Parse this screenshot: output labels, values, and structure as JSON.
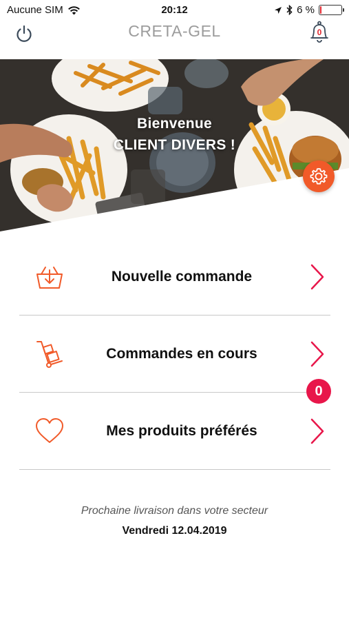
{
  "status_bar": {
    "carrier": "Aucune SIM",
    "time": "20:12",
    "battery_text": "6 %",
    "battery_level": 0.06,
    "icons": [
      "wifi-icon",
      "location-arrow-icon",
      "bluetooth-icon",
      "battery-icon"
    ]
  },
  "header": {
    "title": "CRETA-GEL",
    "notification_count": "0",
    "icons": [
      "power-icon",
      "bell-icon"
    ]
  },
  "hero": {
    "greeting": "Bienvenue",
    "client_name": "CLIENT DIVERS !",
    "settings_icon": "gear-icon"
  },
  "menu": {
    "items": [
      {
        "label": "Nouvelle commande",
        "icon": "basket-icon"
      },
      {
        "label": "Commandes en cours",
        "icon": "hand-truck-icon"
      },
      {
        "label": "Mes produits préférés",
        "icon": "heart-icon"
      }
    ],
    "orders_badge": "0"
  },
  "delivery": {
    "note": "Prochaine livraison dans votre secteur",
    "date": "Vendredi 12.04.2019"
  },
  "colors": {
    "accent": "#f15a29",
    "chevron": "#e8164a",
    "badge": "#e8164a",
    "title_gray": "#9c9c9c"
  }
}
